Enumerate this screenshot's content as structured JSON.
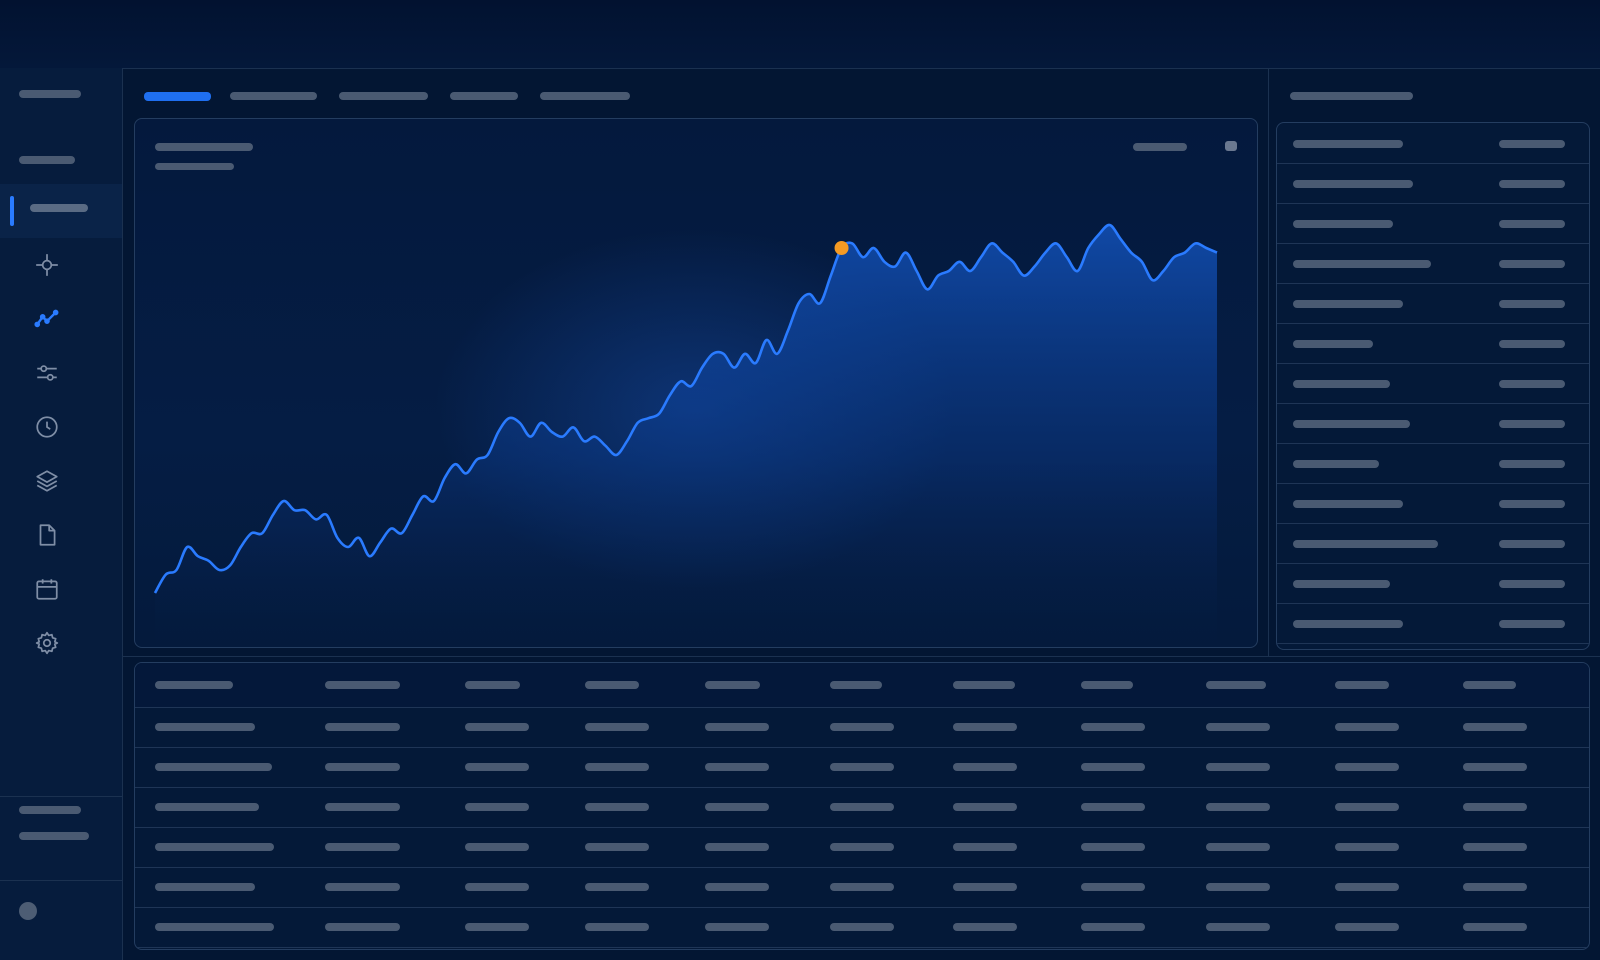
{
  "colors": {
    "accent": "#1f6ff0",
    "line": "#2a7bff",
    "peak_marker": "#f59a23",
    "background": "#031633"
  },
  "sidebar": {
    "icons": [
      "crosshair-icon",
      "line-chart-icon",
      "sliders-icon",
      "clock-icon",
      "layers-icon",
      "document-icon",
      "calendar-icon",
      "gear-icon"
    ],
    "active_icon": "line-chart-icon"
  },
  "header": {
    "tabs_count": 5,
    "active_tab_index": 0
  },
  "chart_data": {
    "type": "area",
    "x": [
      0,
      1,
      2,
      3,
      4,
      5,
      6,
      7,
      8,
      9,
      10,
      11,
      12,
      13,
      14,
      15,
      16,
      17,
      18,
      19,
      20,
      21,
      22,
      23,
      24,
      25,
      26,
      27,
      28,
      29,
      30,
      31,
      32,
      33,
      34,
      35,
      36,
      37,
      38,
      39,
      40,
      41,
      42,
      43,
      44,
      45,
      46,
      47,
      48,
      49,
      50,
      51,
      52,
      53,
      54,
      55,
      56,
      57,
      58,
      59,
      60,
      61,
      62,
      63,
      64,
      65,
      66,
      67,
      68,
      69,
      70,
      71,
      72,
      73,
      74,
      75,
      76,
      77,
      78,
      79,
      80,
      81,
      82,
      83,
      84,
      85,
      86,
      87,
      88,
      89,
      90,
      91,
      92,
      93,
      94,
      95,
      96,
      97,
      98,
      99
    ],
    "values": [
      10,
      14,
      15,
      20,
      18,
      17,
      15,
      16,
      20,
      23,
      23,
      27,
      30,
      28,
      28,
      26,
      27,
      22,
      20,
      22,
      18,
      21,
      24,
      23,
      27,
      31,
      30,
      35,
      38,
      36,
      39,
      40,
      45,
      48,
      47,
      44,
      47,
      45,
      44,
      46,
      43,
      44,
      42,
      40,
      43,
      47,
      48,
      49,
      53,
      56,
      55,
      59,
      62,
      62,
      59,
      62,
      60,
      65,
      62,
      67,
      73,
      75,
      73,
      79,
      85,
      86,
      83,
      85,
      82,
      81,
      84,
      80,
      76,
      79,
      80,
      82,
      80,
      83,
      86,
      84,
      82,
      79,
      81,
      84,
      86,
      83,
      80,
      85,
      88,
      90,
      87,
      84,
      82,
      78,
      80,
      83,
      84,
      86,
      85,
      84
    ],
    "peak_index": 64,
    "ylim": [
      0,
      100
    ],
    "grid": false
  },
  "right_panel": {
    "rows_count": 13
  },
  "table": {
    "columns_count": 11,
    "rows_count": 6
  }
}
